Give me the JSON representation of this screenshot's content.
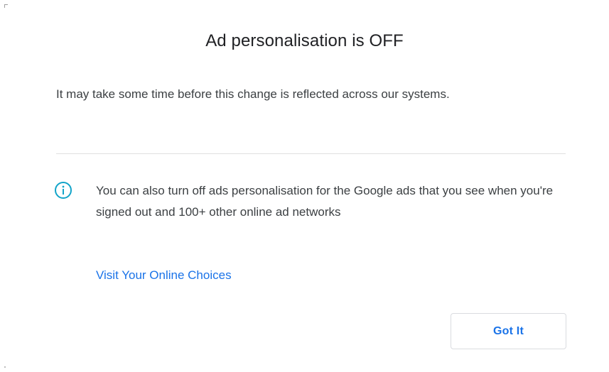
{
  "dialog": {
    "title": "Ad personalisation is OFF",
    "message": "It may take some time before this change is reflected across our systems.",
    "info": {
      "icon": "info-icon",
      "text": "You can also turn off ads personalisation for the Google ads that you see when you're signed out and 100+ other online ad networks",
      "link_label": "Visit Your Online Choices"
    },
    "button_label": "Got It"
  },
  "colors": {
    "accent": "#1a73e8",
    "info_icon": "#12a4c9",
    "text": "#3c4043",
    "title": "#202124",
    "divider": "#e0e0e0"
  }
}
